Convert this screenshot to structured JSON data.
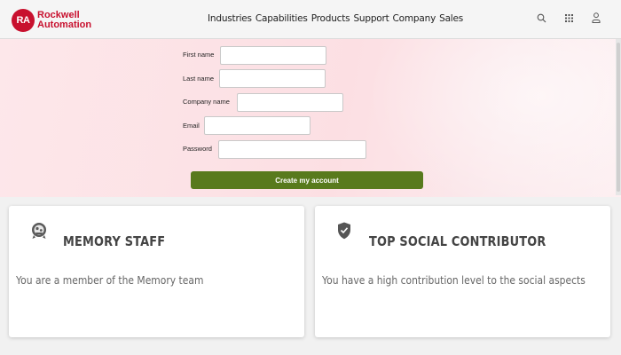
{
  "header": {
    "logo_mark": "RA",
    "logo_line1": "Rockwell",
    "logo_line2": "Automation",
    "nav": [
      "Industries",
      "Capabilities",
      "Products",
      "Support",
      "Company",
      "Sales"
    ],
    "icons": [
      "search-icon",
      "apps-grid-icon",
      "user-icon"
    ]
  },
  "form": {
    "fields": [
      {
        "label": "First name",
        "value": ""
      },
      {
        "label": "Last name",
        "value": ""
      },
      {
        "label": "Company name",
        "value": ""
      },
      {
        "label": "Email",
        "value": ""
      },
      {
        "label": "Password",
        "value": ""
      }
    ],
    "submit_label": "Create my account"
  },
  "cards": [
    {
      "icon": "memory-badge-icon",
      "title": "MEMORY STAFF",
      "description": "You are a member of the Memory team"
    },
    {
      "icon": "shield-check-icon",
      "title": "TOP SOCIAL CONTRIBUTOR",
      "description": "You have a high contribution level to the social aspects"
    }
  ],
  "colors": {
    "brand_red": "#c8102e",
    "button_green": "#587a1d",
    "form_background": "#fce3e7"
  }
}
